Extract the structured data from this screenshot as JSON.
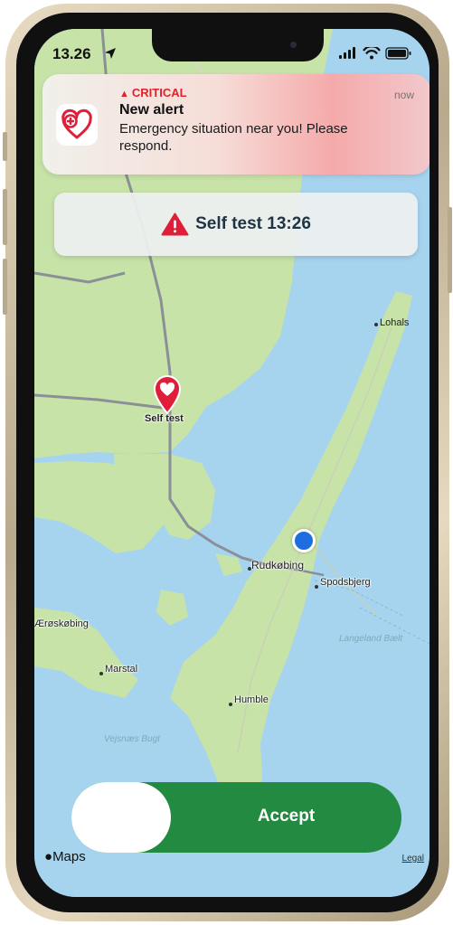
{
  "status_bar": {
    "time": "13.26"
  },
  "notification": {
    "level": "CRITICAL",
    "time": "now",
    "title": "New alert",
    "body": "Emergency situation near you! Please respond.",
    "accent_color": "#e1222a"
  },
  "banner": {
    "text": "Self test 13:26",
    "icon": "warning-triangle-icon"
  },
  "map": {
    "pin_label": "Self test",
    "places": [
      "Lohals",
      "Rudkøbing",
      "Spodsbjerg",
      "Ærøskøbing",
      "Marstal",
      "Humble"
    ],
    "water_labels": [
      "Langeland Bælt",
      "Vejsnæs Bugt"
    ],
    "attribution": "Maps",
    "legal": "Legal"
  },
  "slider": {
    "label": "Accept",
    "color": "#228a41"
  },
  "colors": {
    "water": "#a6d4ef",
    "land": "#c7e3a8",
    "road": "#8a8f98"
  }
}
